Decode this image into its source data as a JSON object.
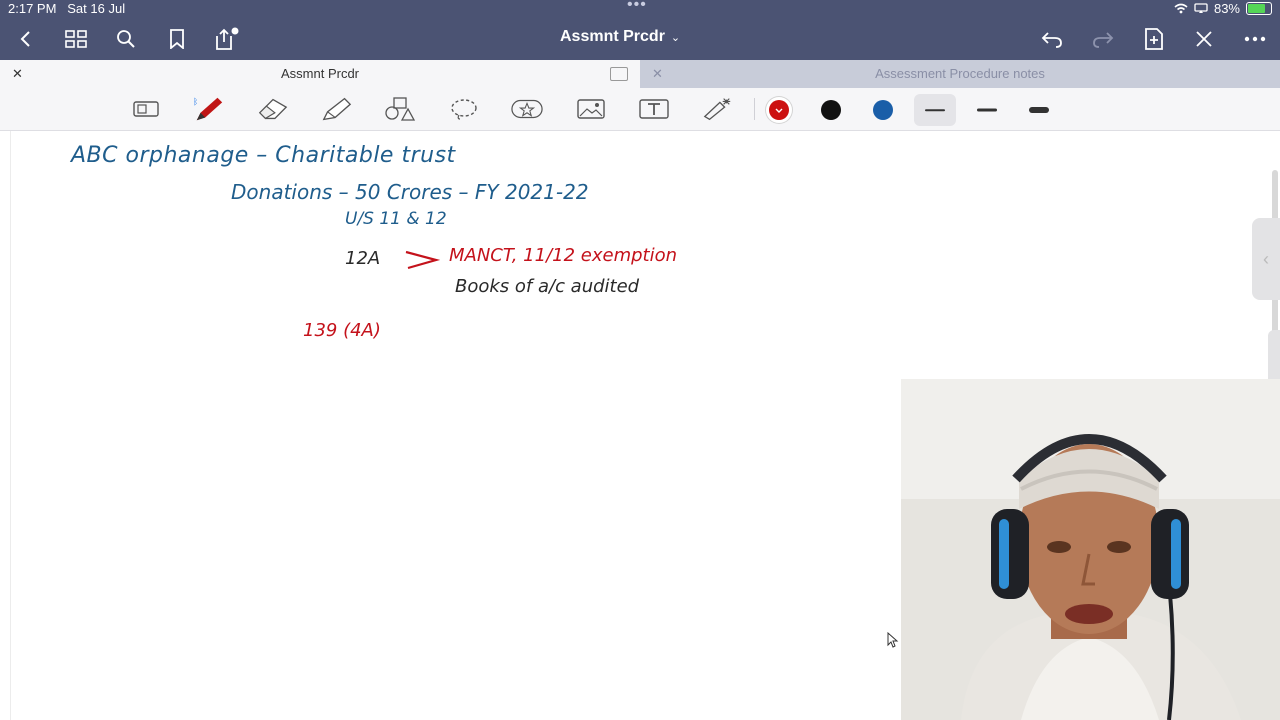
{
  "status": {
    "time": "2:17 PM",
    "date": "Sat 16 Jul",
    "battery": "83%",
    "battery_level": 0.83
  },
  "nav": {
    "title": "Assmnt Prcdr"
  },
  "tabs": [
    {
      "label": "Assmnt Prcdr",
      "active": true
    },
    {
      "label": "Assessment Procedure notes",
      "active": false
    }
  ],
  "toolbar": {
    "colors": [
      "#cc1111",
      "#111111",
      "#1a5ea8"
    ],
    "selected_color_index": 0,
    "tools": [
      "page-layout-icon",
      "pen-icon",
      "eraser-icon",
      "highlighter-icon",
      "shapes-icon",
      "lasso-icon",
      "sticker-icon",
      "image-icon",
      "text-icon",
      "laser-pointer-icon"
    ]
  },
  "notes": {
    "line1": "ABC orphanage – Charitable trust",
    "line2": "Donations – 50 Crores – FY 2021-22",
    "line3": "U/S 11 & 12",
    "line4a": "12A",
    "line4b": "MANCT, 11/12 exemption",
    "line5": "Books of a/c audited",
    "line6": "139 (4A)"
  }
}
